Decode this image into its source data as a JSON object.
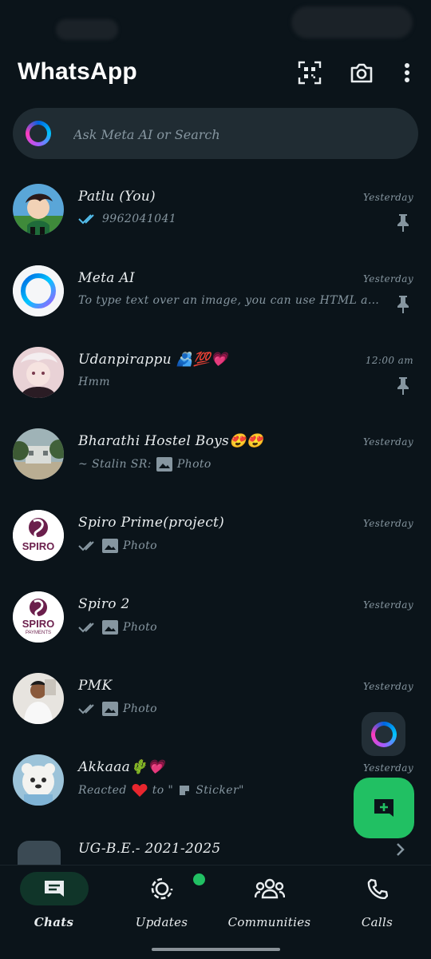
{
  "header": {
    "title": "WhatsApp",
    "icons": [
      "qr-scanner-icon",
      "camera-icon",
      "more-vertical-icon"
    ]
  },
  "search": {
    "placeholder": "Ask Meta AI or Search"
  },
  "chats": [
    {
      "name": "Patlu (You)",
      "time": "Yesterday",
      "preview": "9962041041",
      "status": "read",
      "pinned": true
    },
    {
      "name": "Meta AI",
      "time": "Yesterday",
      "preview": "To type text over an image, you can use HTML and...",
      "pinned": true
    },
    {
      "name": "Udanpirappu 🫂💯💗",
      "time": "12:00 am",
      "preview": "Hmm",
      "pinned": true
    },
    {
      "name": "Bharathi Hostel Boys😍😍",
      "time": "Yesterday",
      "preview_sender": "~ Stalin SR:",
      "preview": "Photo"
    },
    {
      "name": "Spiro Prime(project)",
      "time": "Yesterday",
      "preview": "Photo",
      "status": "delivered"
    },
    {
      "name": "Spiro 2",
      "time": "Yesterday",
      "preview": "Photo",
      "status": "delivered"
    },
    {
      "name": "PMK",
      "time": "Yesterday",
      "preview": "Photo",
      "status": "delivered"
    },
    {
      "name": "Akkaaa🌵💗",
      "time": "Yesterday",
      "preview_prefix": "Reacted",
      "preview_middle": "to \"",
      "preview": "Sticker\""
    },
    {
      "name": "UG-B.E.- 2021-2025"
    }
  ],
  "avatars": {
    "spiro_text": "SPIRO",
    "spiro2_sub": "PAYMENTS"
  },
  "bottom_nav": [
    {
      "label": "Chats",
      "active": true
    },
    {
      "label": "Updates",
      "badge": true
    },
    {
      "label": "Communities"
    },
    {
      "label": "Calls"
    }
  ],
  "colors": {
    "background": "#0b141a",
    "search_bg": "#202c33",
    "accent_green": "#21c063",
    "read_tick": "#53bdeb",
    "muted_text": "#8696a0"
  }
}
